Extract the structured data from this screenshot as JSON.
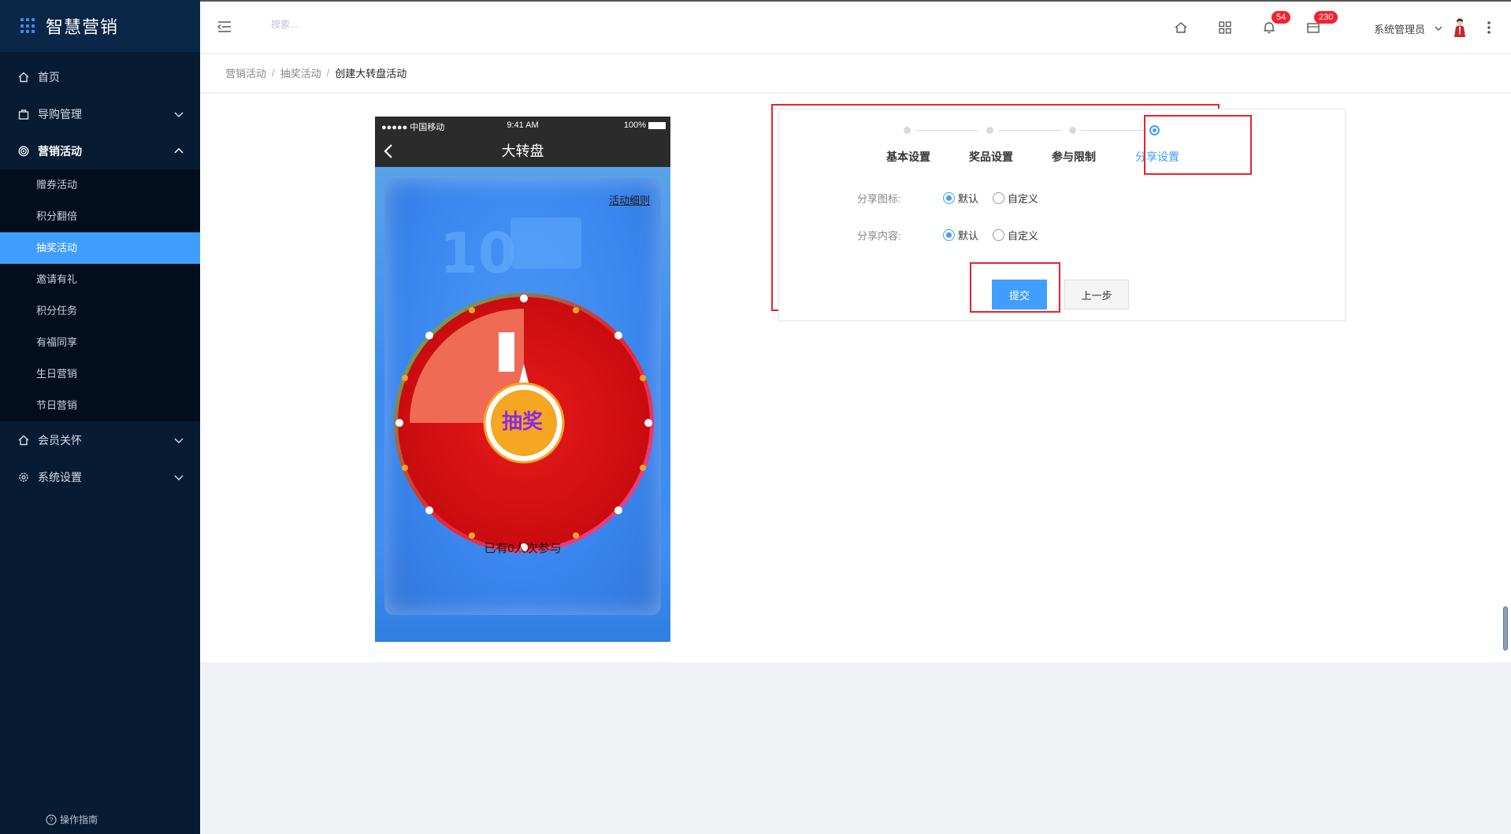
{
  "brand": {
    "title": "智慧营销"
  },
  "sidebar": {
    "items": [
      {
        "label": "首页",
        "icon": "home-icon"
      },
      {
        "label": "导购管理",
        "icon": "bag-icon"
      },
      {
        "label": "营销活动",
        "icon": "target-icon"
      },
      {
        "label": "会员关怀",
        "icon": "home-icon"
      },
      {
        "label": "系统设置",
        "icon": "gear-icon"
      }
    ],
    "submenu": [
      {
        "label": "赠券活动"
      },
      {
        "label": "积分翻倍"
      },
      {
        "label": "抽奖活动",
        "active": true
      },
      {
        "label": "邀请有礼"
      },
      {
        "label": "积分任务"
      },
      {
        "label": "有福同享"
      },
      {
        "label": "生日营销"
      },
      {
        "label": "节日营销"
      }
    ],
    "guide": "操作指南"
  },
  "header": {
    "search_placeholder": "搜索...",
    "notifications_count": "54",
    "messages_count": "230",
    "user_name": "系统管理员"
  },
  "breadcrumb": [
    "营销活动",
    "抽奖活动",
    "创建大转盘活动"
  ],
  "phone": {
    "carrier": "●●●●● 中国移动",
    "time": "9:41 AM",
    "battery": "100%",
    "nav_title": "大转盘",
    "rules_link": "活动细则",
    "center_button": "抽奖",
    "participants": "已有0人次参与"
  },
  "steps": [
    {
      "label": "基本设置"
    },
    {
      "label": "奖品设置"
    },
    {
      "label": "参与限制"
    },
    {
      "label": "分享设置",
      "active": true
    }
  ],
  "form": {
    "share_icon": {
      "label": "分享图标:",
      "options": [
        "默认",
        "自定义"
      ],
      "selected": "默认"
    },
    "share_content": {
      "label": "分享内容:",
      "options": [
        "默认",
        "自定义"
      ],
      "selected": "默认"
    },
    "submit_label": "提交",
    "prev_label": "上一步"
  },
  "colors": {
    "accent": "#409eff",
    "sidebar_bg": "#071b33",
    "highlight": "#e8232b",
    "wheel_red": "#d90f12"
  }
}
